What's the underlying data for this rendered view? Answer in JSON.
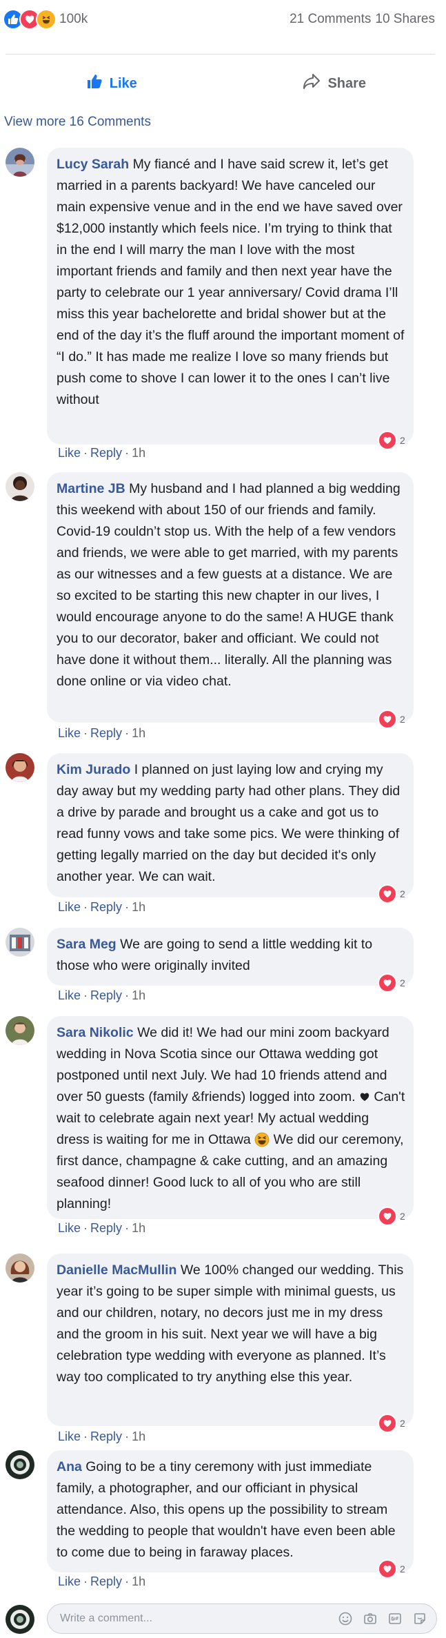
{
  "reactions": {
    "count": "100k",
    "comments": "21 Comments",
    "shares": "10 Shares",
    "icons": [
      "like-icon",
      "love-icon",
      "haha-icon"
    ]
  },
  "actions": {
    "like_label": "Like",
    "share_label": "Share"
  },
  "view_more": "View more 16 Comments",
  "comment_meta": {
    "like": "Like",
    "dot": "·",
    "reply": "Reply",
    "time": "1h"
  },
  "comments": [
    {
      "author": "Lucy Sarah",
      "text": "My fiancé and I have said screw it, let’s get married in a parents backyard! We have canceled our main expensive venue and in the end we have saved over $12,000 instantly which feels nice. I’m trying to think that in the end I will marry the man I love with the most important friends and family and then next year have the party to celebrate our 1 year anniversary/ Covid drama I’ll miss this year bachelorette and bridal shower but at the end of the day it’s the fluff around the important moment of “I do.” It has made me realize I love so many friends but push come to shove I can lower it to the ones I can’t live without",
      "reactions": "2"
    },
    {
      "author": "Martine JB",
      "text": "My husband and I had planned a big wedding this weekend with about 150 of our friends and family. Covid-19 couldn’t stop us. With the help of a few vendors and friends, we were able to get married, with my parents as our witnesses and a few guests at a distance. We are so excited to be starting this new chapter in our lives, I would encourage anyone to do the same! A HUGE thank you to our decorator, baker and officiant. We could not have done it without them... literally. All the planning was done online or via video chat.",
      "reactions": "2"
    },
    {
      "author": "Kim Jurado",
      "text": "I planned on just laying low and crying my day away but my wedding party had other plans. They did a drive by parade and brought us a cake and got us to read funny vows and take some pics. We were thinking of getting legally married on the day but decided it's only another year. We can wait.",
      "reactions": "2"
    },
    {
      "author": "Sara Meg",
      "text": "We are going to send a little wedding kit to those who were originally invited",
      "reactions": "2"
    },
    {
      "author": "Sara Nikolic",
      "text_before": "We did it! We had our mini zoom backyard wedding in Nova Scotia since our Ottawa wedding got postponed until next July. We had 10 friends attend and over 50 guests (family &friends) logged into zoom.",
      "text_middle": "Can't wait to celebrate again next year! My actual wedding dress is waiting for me in Ottawa",
      "text_after": "We did our ceremony, first dance, champagne & cake cutting, and an amazing seafood dinner! Good luck to all of you who are still planning!",
      "reactions": "2"
    },
    {
      "author": "Danielle MacMullin",
      "text": "We 100% changed our wedding. This year it’s going to be super simple with minimal guests, us and our children, notary, no decors just me in my dress and the groom in his suit. Next year we will have a big celebration type wedding with everyone as planned. It’s way too complicated to try anything else this year.",
      "reactions": "2"
    },
    {
      "author": "Ana",
      "text": "Going to be a tiny ceremony with just immediate family, a photographer, and our officiant in physical attendance. Also, this opens up the possibility to stream the wedding to people that wouldn't have even been able to come due to being in faraway places.",
      "reactions": "2"
    }
  ],
  "write_comment": {
    "placeholder": "Write a comment...",
    "icons": [
      "emoji-icon",
      "camera-icon",
      "gif-icon",
      "sticker-icon"
    ]
  },
  "colors": {
    "link": "#385898",
    "accent": "#1877f2",
    "love": "#f33e58",
    "bubble": "#f0f2f5"
  }
}
